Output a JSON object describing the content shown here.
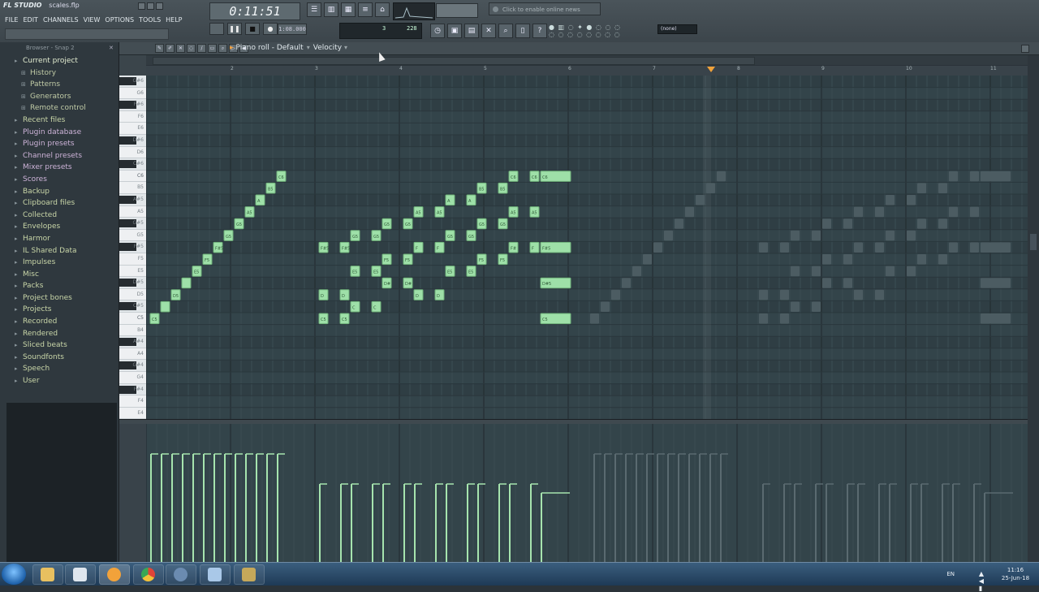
{
  "app": {
    "title": "FL STUDIO",
    "file_name": "scales.flp",
    "menu": [
      "FILE",
      "EDIT",
      "CHANNELS",
      "VIEW",
      "OPTIONS",
      "TOOLS",
      "HELP"
    ],
    "time": "0:11:51",
    "tempo": "1:08.000",
    "pattern_label": "3",
    "pattern_value": "228",
    "news": "Click to enable online news",
    "output": "(none)"
  },
  "browser": {
    "header": "Browser - Snap 2",
    "items": [
      {
        "label": "Current project",
        "level": 0,
        "kind": "current"
      },
      {
        "label": "History",
        "level": 1
      },
      {
        "label": "Patterns",
        "level": 1
      },
      {
        "label": "Generators",
        "level": 1
      },
      {
        "label": "Remote control",
        "level": 1
      },
      {
        "label": "Recent files",
        "level": 0
      },
      {
        "label": "Plugin database",
        "level": 0,
        "kind": "alt"
      },
      {
        "label": "Plugin presets",
        "level": 0,
        "kind": "alt"
      },
      {
        "label": "Channel presets",
        "level": 0,
        "kind": "alt"
      },
      {
        "label": "Mixer presets",
        "level": 0,
        "kind": "alt"
      },
      {
        "label": "Scores",
        "level": 0,
        "kind": "alt"
      },
      {
        "label": "Backup",
        "level": 0
      },
      {
        "label": "Clipboard files",
        "level": 0
      },
      {
        "label": "Collected",
        "level": 0
      },
      {
        "label": "Envelopes",
        "level": 0
      },
      {
        "label": "Harmor",
        "level": 0
      },
      {
        "label": "IL Shared Data",
        "level": 0
      },
      {
        "label": "Impulses",
        "level": 0
      },
      {
        "label": "Misc",
        "level": 0
      },
      {
        "label": "Packs",
        "level": 0
      },
      {
        "label": "Project bones",
        "level": 0
      },
      {
        "label": "Projects",
        "level": 0
      },
      {
        "label": "Recorded",
        "level": 0
      },
      {
        "label": "Rendered",
        "level": 0
      },
      {
        "label": "Sliced beats",
        "level": 0
      },
      {
        "label": "Soundfonts",
        "level": 0
      },
      {
        "label": "Speech",
        "level": 0
      },
      {
        "label": "User",
        "level": 0
      }
    ]
  },
  "piano_roll": {
    "title": "Piano roll - Default",
    "mode": "Velocity",
    "ruler": [
      "2",
      "3",
      "4",
      "5",
      "6",
      "7",
      "8",
      "9",
      "10",
      "11"
    ],
    "keys": [
      "G#6",
      "G6",
      "F#6",
      "F6",
      "E6",
      "D#6",
      "D6",
      "C#6",
      "C6",
      "B5",
      "A#5",
      "A5",
      "G#5",
      "G5",
      "F#5",
      "F5",
      "E5",
      "D#5",
      "D5",
      "C#5",
      "C5",
      "B4",
      "A#4",
      "A4",
      "G#4",
      "G4",
      "F#4",
      "F4",
      "E4"
    ],
    "notes": [
      {
        "key": "C5",
        "x": 0,
        "w": 1,
        "label": "C5"
      },
      {
        "key": "C#5",
        "x": 1,
        "w": 1,
        "label": ""
      },
      {
        "key": "D5",
        "x": 2,
        "w": 1,
        "label": "D5"
      },
      {
        "key": "D#5",
        "x": 3,
        "w": 1,
        "label": ""
      },
      {
        "key": "E5",
        "x": 4,
        "w": 1,
        "label": "E5"
      },
      {
        "key": "F5",
        "x": 5,
        "w": 1,
        "label": "F5"
      },
      {
        "key": "F#5",
        "x": 6,
        "w": 1,
        "label": "F#5"
      },
      {
        "key": "G5",
        "x": 7,
        "w": 1,
        "label": "G5"
      },
      {
        "key": "G#5",
        "x": 8,
        "w": 1,
        "label": "G5"
      },
      {
        "key": "A5",
        "x": 9,
        "w": 1,
        "label": "A5"
      },
      {
        "key": "A#5",
        "x": 10,
        "w": 1,
        "label": "A"
      },
      {
        "key": "B5",
        "x": 11,
        "w": 1,
        "label": "B5"
      },
      {
        "key": "C6",
        "x": 12,
        "w": 1,
        "label": "C6"
      },
      {
        "key": "C5",
        "x": 16,
        "w": 1,
        "label": "C5"
      },
      {
        "key": "D5",
        "x": 16,
        "w": 1,
        "label": "D"
      },
      {
        "key": "F#5",
        "x": 16,
        "w": 1,
        "label": "F#5"
      },
      {
        "key": "C5",
        "x": 18,
        "w": 1,
        "label": "C5"
      },
      {
        "key": "D5",
        "x": 18,
        "w": 1,
        "label": "D"
      },
      {
        "key": "F#5",
        "x": 18,
        "w": 1,
        "label": "F#5"
      },
      {
        "key": "C#5",
        "x": 19,
        "w": 1,
        "label": "C"
      },
      {
        "key": "E5",
        "x": 19,
        "w": 1,
        "label": "E5"
      },
      {
        "key": "G5",
        "x": 19,
        "w": 1,
        "label": "G5"
      },
      {
        "key": "C#5",
        "x": 21,
        "w": 1,
        "label": "C"
      },
      {
        "key": "E5",
        "x": 21,
        "w": 1,
        "label": "E5"
      },
      {
        "key": "G5",
        "x": 21,
        "w": 1,
        "label": "G5"
      },
      {
        "key": "D#5",
        "x": 22,
        "w": 1,
        "label": "D#"
      },
      {
        "key": "F5",
        "x": 22,
        "w": 1,
        "label": "F5"
      },
      {
        "key": "G#5",
        "x": 22,
        "w": 1,
        "label": "G5"
      },
      {
        "key": "D#5",
        "x": 24,
        "w": 1,
        "label": "D#"
      },
      {
        "key": "F5",
        "x": 24,
        "w": 1,
        "label": "F5"
      },
      {
        "key": "G#5",
        "x": 24,
        "w": 1,
        "label": "G5"
      },
      {
        "key": "D5",
        "x": 25,
        "w": 1,
        "label": "D"
      },
      {
        "key": "F#5",
        "x": 25,
        "w": 1,
        "label": "F"
      },
      {
        "key": "A5",
        "x": 25,
        "w": 1,
        "label": "A5"
      },
      {
        "key": "D5",
        "x": 27,
        "w": 1,
        "label": "D"
      },
      {
        "key": "F#5",
        "x": 27,
        "w": 1,
        "label": "F"
      },
      {
        "key": "A5",
        "x": 27,
        "w": 1,
        "label": "A5"
      },
      {
        "key": "E5",
        "x": 28,
        "w": 1,
        "label": "E5"
      },
      {
        "key": "G5",
        "x": 28,
        "w": 1,
        "label": "G5"
      },
      {
        "key": "A#5",
        "x": 28,
        "w": 1,
        "label": "A"
      },
      {
        "key": "E5",
        "x": 30,
        "w": 1,
        "label": "E5"
      },
      {
        "key": "G5",
        "x": 30,
        "w": 1,
        "label": "G5"
      },
      {
        "key": "A#5",
        "x": 30,
        "w": 1,
        "label": "A"
      },
      {
        "key": "F5",
        "x": 31,
        "w": 1,
        "label": "F5"
      },
      {
        "key": "G#5",
        "x": 31,
        "w": 1,
        "label": "G5"
      },
      {
        "key": "B5",
        "x": 31,
        "w": 1,
        "label": "B5"
      },
      {
        "key": "F5",
        "x": 33,
        "w": 1,
        "label": "F5"
      },
      {
        "key": "G#5",
        "x": 33,
        "w": 1,
        "label": "G5"
      },
      {
        "key": "B5",
        "x": 33,
        "w": 1,
        "label": "B5"
      },
      {
        "key": "F#5",
        "x": 34,
        "w": 1,
        "label": "F#"
      },
      {
        "key": "A5",
        "x": 34,
        "w": 1,
        "label": "A5"
      },
      {
        "key": "C6",
        "x": 34,
        "w": 1,
        "label": "C6"
      },
      {
        "key": "F#5",
        "x": 36,
        "w": 1,
        "label": "F"
      },
      {
        "key": "A5",
        "x": 36,
        "w": 1,
        "label": "A5"
      },
      {
        "key": "C6",
        "x": 36,
        "w": 1,
        "label": "C6"
      },
      {
        "key": "C5",
        "x": 37,
        "w": 3,
        "label": "C5"
      },
      {
        "key": "D#5",
        "x": 37,
        "w": 3,
        "label": "D#5"
      },
      {
        "key": "F#5",
        "x": 37,
        "w": 3,
        "label": "F#5"
      },
      {
        "key": "C6",
        "x": 37,
        "w": 3,
        "label": "C6"
      }
    ],
    "ghost_notes": [
      {
        "key": "C5",
        "x": 42,
        "w": 1
      },
      {
        "key": "C#5",
        "x": 43,
        "w": 1
      },
      {
        "key": "D5",
        "x": 44,
        "w": 1
      },
      {
        "key": "D#5",
        "x": 45,
        "w": 1
      },
      {
        "key": "E5",
        "x": 46,
        "w": 1
      },
      {
        "key": "F5",
        "x": 47,
        "w": 1
      },
      {
        "key": "F#5",
        "x": 48,
        "w": 1
      },
      {
        "key": "G5",
        "x": 49,
        "w": 1
      },
      {
        "key": "G#5",
        "x": 50,
        "w": 1
      },
      {
        "key": "A5",
        "x": 51,
        "w": 1
      },
      {
        "key": "A#5",
        "x": 52,
        "w": 1
      },
      {
        "key": "B5",
        "x": 53,
        "w": 1
      },
      {
        "key": "C6",
        "x": 54,
        "w": 1
      },
      {
        "key": "C5",
        "x": 58,
        "w": 1
      },
      {
        "key": "D5",
        "x": 58,
        "w": 1
      },
      {
        "key": "F#5",
        "x": 58,
        "w": 1
      },
      {
        "key": "C5",
        "x": 60,
        "w": 1
      },
      {
        "key": "D5",
        "x": 60,
        "w": 1
      },
      {
        "key": "F#5",
        "x": 60,
        "w": 1
      },
      {
        "key": "C#5",
        "x": 61,
        "w": 1
      },
      {
        "key": "E5",
        "x": 61,
        "w": 1
      },
      {
        "key": "G5",
        "x": 61,
        "w": 1
      },
      {
        "key": "C#5",
        "x": 63,
        "w": 1
      },
      {
        "key": "E5",
        "x": 63,
        "w": 1
      },
      {
        "key": "G5",
        "x": 63,
        "w": 1
      },
      {
        "key": "D#5",
        "x": 64,
        "w": 1
      },
      {
        "key": "F5",
        "x": 64,
        "w": 1
      },
      {
        "key": "G#5",
        "x": 64,
        "w": 1
      },
      {
        "key": "D#5",
        "x": 66,
        "w": 1
      },
      {
        "key": "F5",
        "x": 66,
        "w": 1
      },
      {
        "key": "G#5",
        "x": 66,
        "w": 1
      },
      {
        "key": "D5",
        "x": 67,
        "w": 1
      },
      {
        "key": "F#5",
        "x": 67,
        "w": 1
      },
      {
        "key": "A5",
        "x": 67,
        "w": 1
      },
      {
        "key": "D5",
        "x": 69,
        "w": 1
      },
      {
        "key": "F#5",
        "x": 69,
        "w": 1
      },
      {
        "key": "A5",
        "x": 69,
        "w": 1
      },
      {
        "key": "E5",
        "x": 70,
        "w": 1
      },
      {
        "key": "G5",
        "x": 70,
        "w": 1
      },
      {
        "key": "A#5",
        "x": 70,
        "w": 1
      },
      {
        "key": "E5",
        "x": 72,
        "w": 1
      },
      {
        "key": "G5",
        "x": 72,
        "w": 1
      },
      {
        "key": "A#5",
        "x": 72,
        "w": 1
      },
      {
        "key": "F5",
        "x": 73,
        "w": 1
      },
      {
        "key": "G#5",
        "x": 73,
        "w": 1
      },
      {
        "key": "B5",
        "x": 73,
        "w": 1
      },
      {
        "key": "F5",
        "x": 75,
        "w": 1
      },
      {
        "key": "G#5",
        "x": 75,
        "w": 1
      },
      {
        "key": "B5",
        "x": 75,
        "w": 1
      },
      {
        "key": "F#5",
        "x": 76,
        "w": 1
      },
      {
        "key": "A5",
        "x": 76,
        "w": 1
      },
      {
        "key": "C6",
        "x": 76,
        "w": 1
      },
      {
        "key": "F#5",
        "x": 78,
        "w": 1
      },
      {
        "key": "A5",
        "x": 78,
        "w": 1
      },
      {
        "key": "C6",
        "x": 78,
        "w": 1
      },
      {
        "key": "C5",
        "x": 79,
        "w": 3
      },
      {
        "key": "D#5",
        "x": 79,
        "w": 3
      },
      {
        "key": "F#5",
        "x": 79,
        "w": 3
      },
      {
        "key": "C6",
        "x": 79,
        "w": 3
      }
    ]
  },
  "taskbar": {
    "lang": "EN",
    "time": "11:16",
    "date": "25-Jun-18"
  },
  "colors": {
    "note": "#9ee0a8",
    "ghost": "#4c5c62",
    "grid_bg": "#33444a",
    "accent": "#f0a23a"
  }
}
